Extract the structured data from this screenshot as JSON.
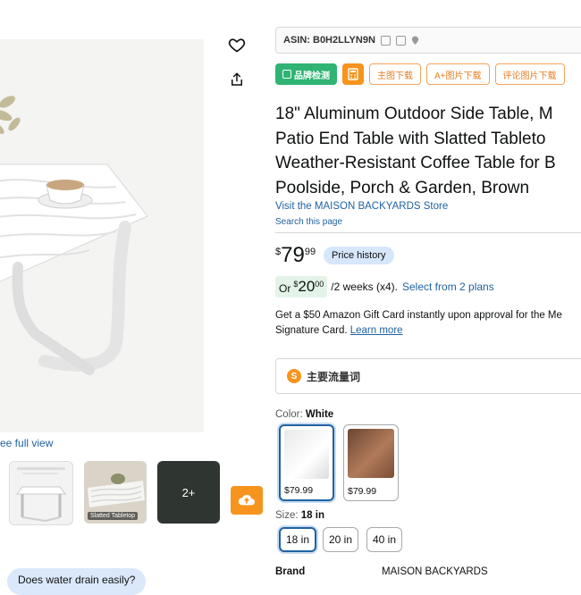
{
  "gallery": {
    "see_full_view": "ee full view",
    "thumb_2_caption": "Slatted Tabletop",
    "thumb_more": "2+",
    "icons": [
      "heart-icon",
      "share-icon",
      "upload-icon"
    ]
  },
  "questions": {
    "q1": "Does water drain easily?"
  },
  "toolbar": {
    "asin_label": "ASIN: B0H2LLYN9N",
    "brand_check": "品牌检测",
    "main_image_download": "主图下载",
    "a_plus_download": "A+图片下载",
    "review_image_download": "评论图片下载"
  },
  "product": {
    "title_lines": [
      "18\" Aluminum Outdoor Side Table, M",
      "Patio End Table with Slatted Tableto",
      "Weather-Resistant Coffee Table for B",
      "Poolside, Porch & Garden, Brown"
    ],
    "store_link": "Visit the MAISON BACKYARDS Store",
    "search_page": "Search this page"
  },
  "price": {
    "currency": "$",
    "whole": "79",
    "fraction": "99",
    "history_button": "Price history"
  },
  "plan": {
    "or": "Or",
    "currency": "$",
    "whole": "20",
    "fraction": "00",
    "text": "/2 weeks (x4).",
    "link": "Select from 2 plans"
  },
  "gift": {
    "line1": "Get a $50 Amazon Gift Card instantly upon approval for the Me",
    "line2": "Signature Card.",
    "learn_more": "Learn more"
  },
  "keywords": {
    "label": "主要流量词"
  },
  "color": {
    "label": "Color:",
    "selected": "White",
    "options": [
      {
        "name": "White",
        "price": "$79.99"
      },
      {
        "name": "Brown",
        "price": "$79.99"
      }
    ]
  },
  "size": {
    "label": "Size:",
    "selected": "18 in",
    "options": [
      "18 in",
      "20 in",
      "40 in"
    ]
  },
  "specs": {
    "brand_label": "Brand",
    "brand_value": "MAISON BACKYARDS"
  },
  "colors": {
    "link": "#2162A1",
    "accent_orange": "#F7941D",
    "brand_green": "#2FB473"
  }
}
